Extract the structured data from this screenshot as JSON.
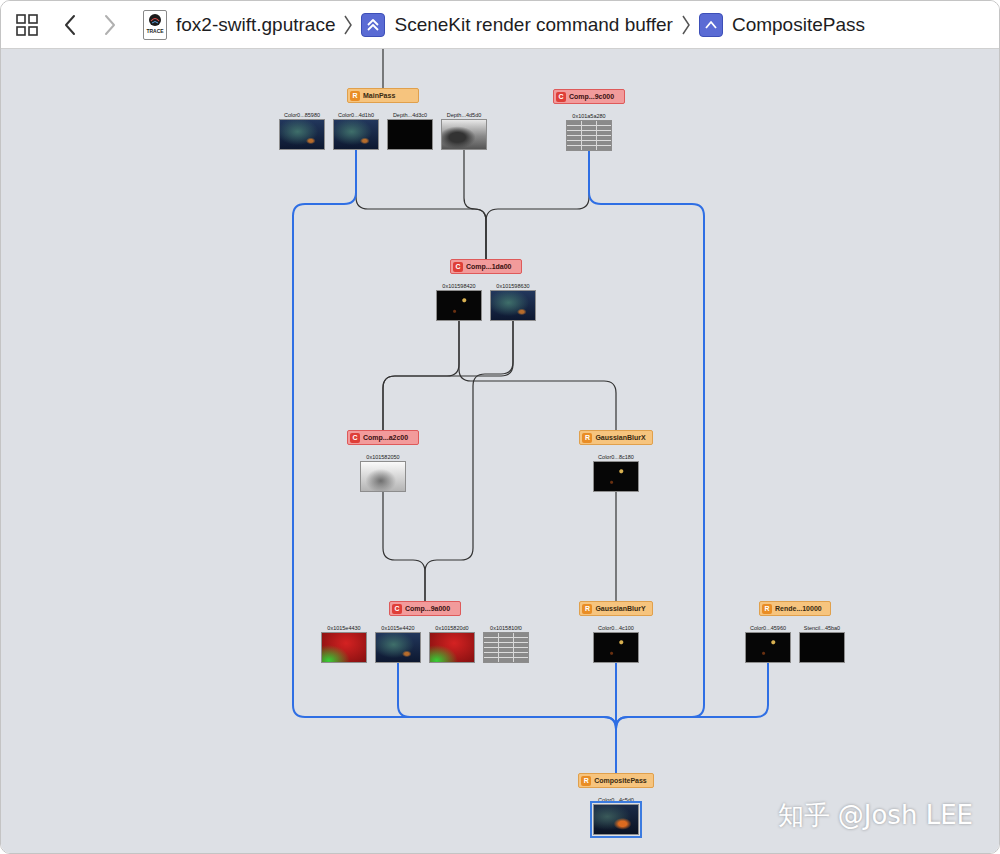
{
  "toolbar": {
    "back_enabled": true,
    "forward_enabled": false,
    "breadcrumbs": [
      {
        "label": "fox2-swift.gputrace",
        "kind": "trace",
        "icon_text": "TRACE"
      },
      {
        "label": "SceneKit render command buffer",
        "kind": "command-buffer"
      },
      {
        "label": "CompositePass",
        "kind": "encoder"
      }
    ]
  },
  "graph": {
    "nodes": [
      {
        "label": "MainPass",
        "badge": "R",
        "kind": "render",
        "outputs": [
          {
            "caption": "Color0...85980",
            "preview": "scene",
            "selected": false
          },
          {
            "caption": "Color0...4d1b0",
            "preview": "scene",
            "selected": false
          },
          {
            "caption": "Depth...4d3c0",
            "preview": "black",
            "selected": false
          },
          {
            "caption": "Depth...4d5d0",
            "preview": "depth",
            "selected": false
          }
        ]
      },
      {
        "label": "Comp...9c000",
        "badge": "C",
        "kind": "compute",
        "outputs": [
          {
            "caption": "0x101a5a280",
            "preview": "buffer",
            "selected": false
          }
        ]
      },
      {
        "label": "Comp...1da00",
        "badge": "C",
        "kind": "compute",
        "outputs": [
          {
            "caption": "0x101598420",
            "preview": "glow",
            "selected": false
          },
          {
            "caption": "0x101598630",
            "preview": "scene",
            "selected": false
          }
        ]
      },
      {
        "label": "Comp...a2c00",
        "badge": "C",
        "kind": "compute",
        "outputs": [
          {
            "caption": "0x101582050",
            "preview": "gray",
            "selected": false
          }
        ]
      },
      {
        "label": "GaussianBlurX",
        "badge": "R",
        "kind": "render",
        "outputs": [
          {
            "caption": "Color0...8c180",
            "preview": "glow",
            "selected": false
          }
        ]
      },
      {
        "label": "Comp...9a000",
        "badge": "C",
        "kind": "compute",
        "outputs": [
          {
            "caption": "0x1015e4430",
            "preview": "heat",
            "selected": false
          },
          {
            "caption": "0x1015e4420",
            "preview": "scene",
            "selected": false
          },
          {
            "caption": "0x1015820d0",
            "preview": "heat",
            "selected": false
          },
          {
            "caption": "0x1015810f0",
            "preview": "buffer",
            "selected": false
          }
        ]
      },
      {
        "label": "GaussianBlurY",
        "badge": "R",
        "kind": "render",
        "outputs": [
          {
            "caption": "Color0...4c100",
            "preview": "glow",
            "selected": false
          }
        ]
      },
      {
        "label": "Rende...10000",
        "badge": "R",
        "kind": "render",
        "outputs": [
          {
            "caption": "Color0...45960",
            "preview": "glow",
            "selected": false
          },
          {
            "caption": "Stencil...45ba0",
            "preview": "black",
            "selected": false
          }
        ]
      },
      {
        "label": "CompositePass",
        "badge": "R",
        "kind": "render",
        "outputs": [
          {
            "caption": "Color0...4c5d0",
            "preview": "composite",
            "selected": true
          }
        ]
      }
    ],
    "edges": [
      {
        "from": "MainPass",
        "output": 1,
        "to": "Comp...1da00",
        "highlighted": false
      },
      {
        "from": "MainPass",
        "output": 3,
        "to": "Comp...1da00",
        "highlighted": false
      },
      {
        "from": "Comp...9c000",
        "output": 0,
        "to": "Comp...1da00",
        "highlighted": false
      },
      {
        "from": "Comp...1da00",
        "output": 0,
        "to": "Comp...a2c00",
        "highlighted": false
      },
      {
        "from": "Comp...1da00",
        "output": 1,
        "to": "Comp...a2c00",
        "highlighted": false
      },
      {
        "from": "Comp...1da00",
        "output": 0,
        "to": "GaussianBlurX",
        "highlighted": false
      },
      {
        "from": "Comp...1da00",
        "output": 1,
        "to": "Comp...9a000",
        "highlighted": false
      },
      {
        "from": "Comp...a2c00",
        "output": 0,
        "to": "Comp...9a000",
        "highlighted": false
      },
      {
        "from": "GaussianBlurX",
        "output": 0,
        "to": "GaussianBlurY",
        "highlighted": false
      },
      {
        "from": "MainPass",
        "output": 1,
        "to": "CompositePass",
        "highlighted": true
      },
      {
        "from": "Comp...9c000",
        "output": 0,
        "to": "CompositePass",
        "highlighted": true
      },
      {
        "from": "Comp...9a000",
        "output": 1,
        "to": "CompositePass",
        "highlighted": true
      },
      {
        "from": "GaussianBlurY",
        "output": 0,
        "to": "CompositePass",
        "highlighted": true
      },
      {
        "from": "Rende...10000",
        "output": 0,
        "to": "CompositePass",
        "highlighted": true
      }
    ]
  },
  "watermark": "知乎 @Josh LEE"
}
